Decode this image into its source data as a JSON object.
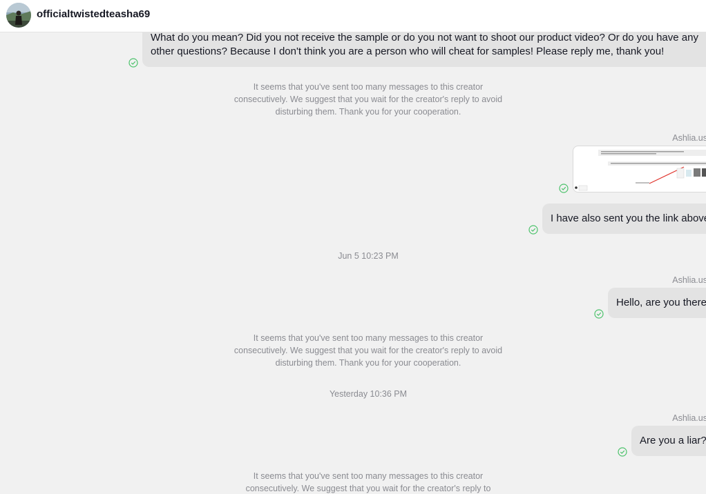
{
  "header": {
    "username": "officialtwistedteasha69"
  },
  "messages": {
    "m1_text": "What do you mean? Did you not receive the sample or do you not want to shoot our product video? Or do you have any other questions? Because I don't think you are a person who will cheat for samples! Please reply me, thank you!",
    "sys1": "It seems that you've sent too many messages to this creator consecutively. We suggest that you wait for the creator's reply to avoid disturbing them. Thank you for your cooperation.",
    "sender1": "Ashlia.us",
    "m3_text": "I have also sent you the link above",
    "time1": "Jun 5 10:23 PM",
    "sender2": "Ashlia.us",
    "m4_text": "Hello, are you there",
    "sys2": "It seems that you've sent too many messages to this creator consecutively. We suggest that you wait for the creator's reply to avoid disturbing them. Thank you for your cooperation.",
    "time2": "Yesterday 10:36 PM",
    "sender3": "Ashlia.us",
    "m5_text": "Are you a liar?",
    "sys3": "It seems that you've sent too many messages to this creator consecutively. We suggest that you wait for the creator's reply to"
  },
  "colors": {
    "read_check": "#4cc26b",
    "bubble": "#e3e3e3",
    "system_text": "#8a8b91"
  },
  "icons": {
    "status": "read-check-icon"
  }
}
